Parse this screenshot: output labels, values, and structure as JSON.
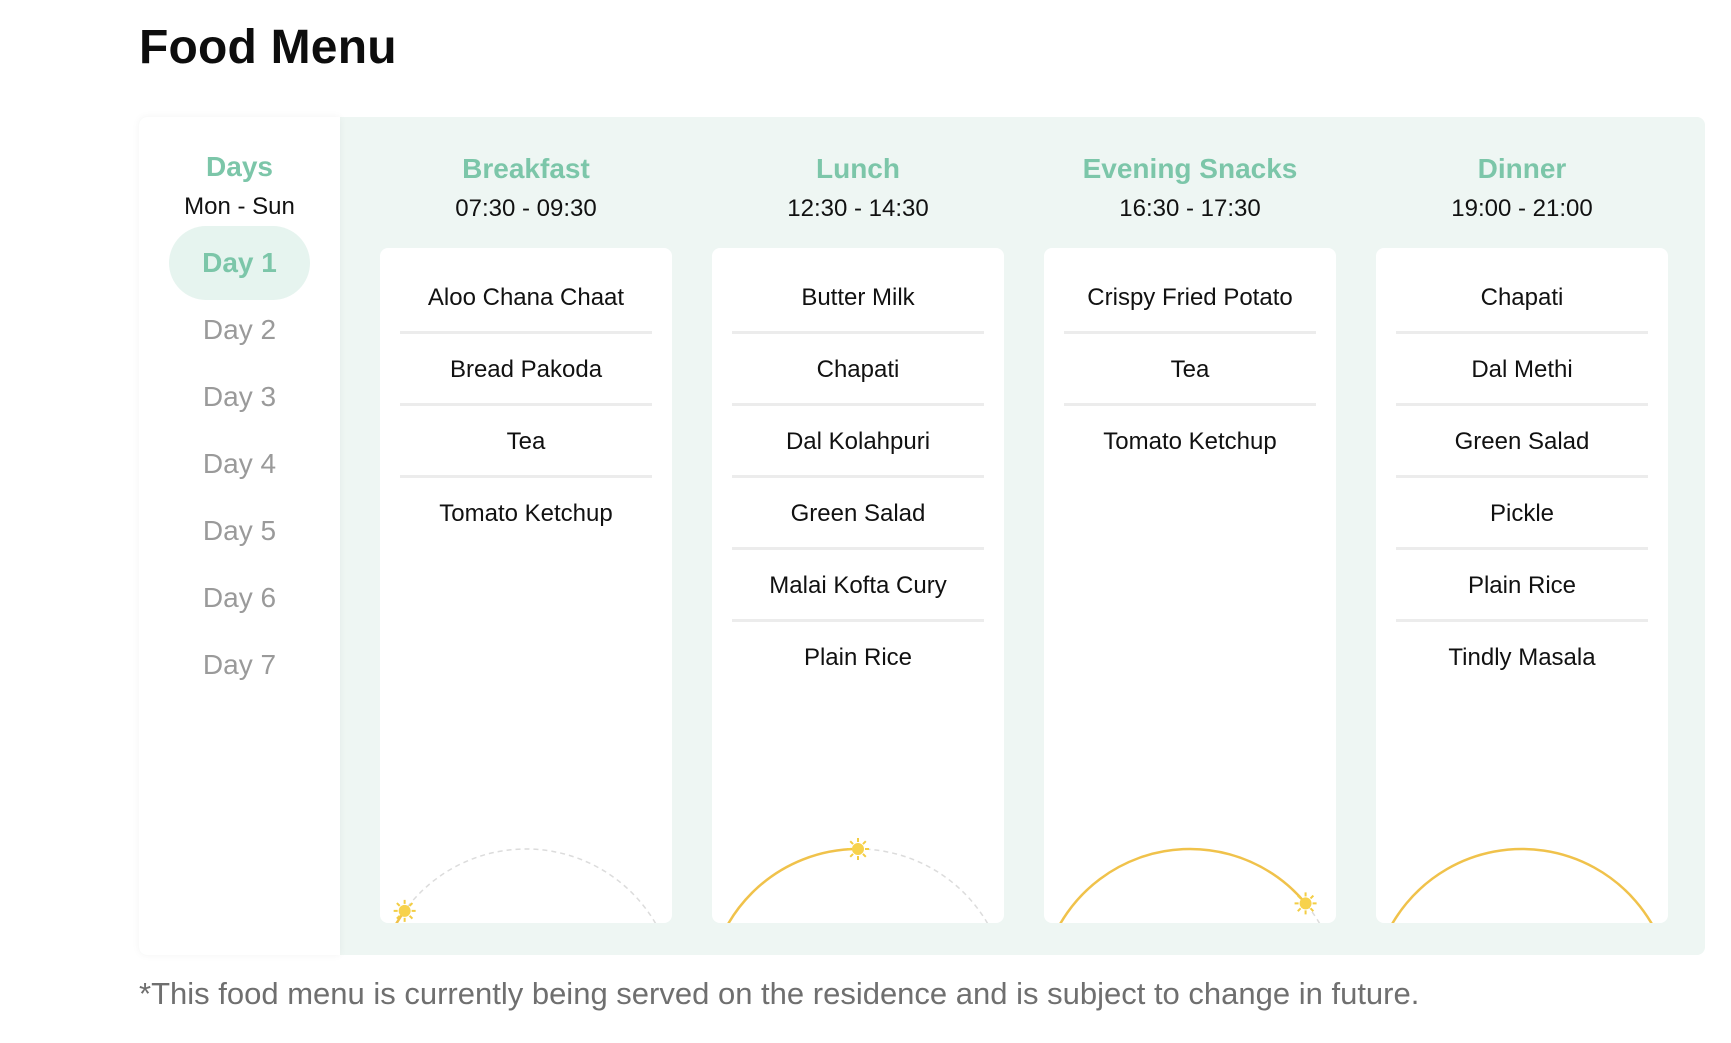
{
  "page": {
    "title": "Food Menu"
  },
  "days": {
    "title": "Days",
    "range": "Mon - Sun",
    "items": [
      "Day 1",
      "Day 2",
      "Day 3",
      "Day 4",
      "Day 5",
      "Day 6",
      "Day 7"
    ],
    "selected": "Day 1"
  },
  "meals": [
    {
      "name": "Breakfast",
      "time": "07:30 - 09:30",
      "items": [
        "Aloo Chana Chaat",
        "Bread Pakoda",
        "Tea",
        "Tomato Ketchup"
      ],
      "icon": "sun-icon",
      "progress": 0.2
    },
    {
      "name": "Lunch",
      "time": "12:30 - 14:30",
      "items": [
        "Butter Milk",
        "Chapati",
        "Dal Kolahpuri",
        "Green Salad",
        "Malai Kofta Cury",
        "Plain Rice"
      ],
      "icon": "sun-icon",
      "progress": 0.5
    },
    {
      "name": "Evening Snacks",
      "time": "16:30 - 17:30",
      "items": [
        "Crispy Fried Potato",
        "Tea",
        "Tomato Ketchup"
      ],
      "icon": "sun-icon",
      "progress": 0.78
    },
    {
      "name": "Dinner",
      "time": "19:00 - 21:00",
      "items": [
        "Chapati",
        "Dal Methi",
        "Green Salad",
        "Pickle",
        "Plain Rice",
        "Tindly Masala"
      ],
      "icon": "moon-icon",
      "progress": 0.88
    }
  ],
  "footnote": "*This food menu is currently being served on the residence and is subject to change in future.",
  "colors": {
    "accent": "#7cc6a9",
    "panel": "#eef6f3",
    "arc": "#f0c24b",
    "muted": "#9a9a9a"
  }
}
